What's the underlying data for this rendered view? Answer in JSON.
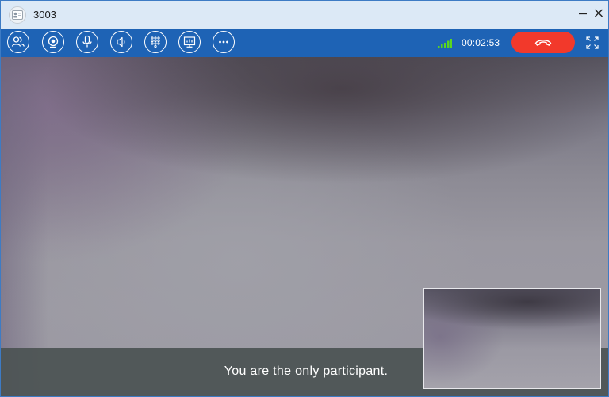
{
  "window": {
    "title": "3003",
    "minimize_icon": "minimize-icon",
    "close_icon": "close-icon"
  },
  "toolbar": {
    "buttons": [
      {
        "name": "participants",
        "icon": "participants-icon"
      },
      {
        "name": "camera",
        "icon": "camera-icon"
      },
      {
        "name": "microphone",
        "icon": "microphone-icon"
      },
      {
        "name": "speaker",
        "icon": "speaker-icon"
      },
      {
        "name": "dialpad",
        "icon": "dialpad-icon"
      },
      {
        "name": "screen-share",
        "icon": "screen-share-icon"
      },
      {
        "name": "more",
        "icon": "more-icon"
      }
    ],
    "signal_icon": "signal-strength-icon",
    "signal_color": "#5bd61e",
    "call_duration": "00:02:53",
    "hangup_icon": "hangup-icon",
    "hangup_color": "#f2392b",
    "fullscreen_icon": "fullscreen-icon"
  },
  "video": {
    "status_message": "You are the only participant."
  },
  "colors": {
    "toolbar_bg": "#1e63b5",
    "titlebar_bg": "#dce9f6"
  }
}
